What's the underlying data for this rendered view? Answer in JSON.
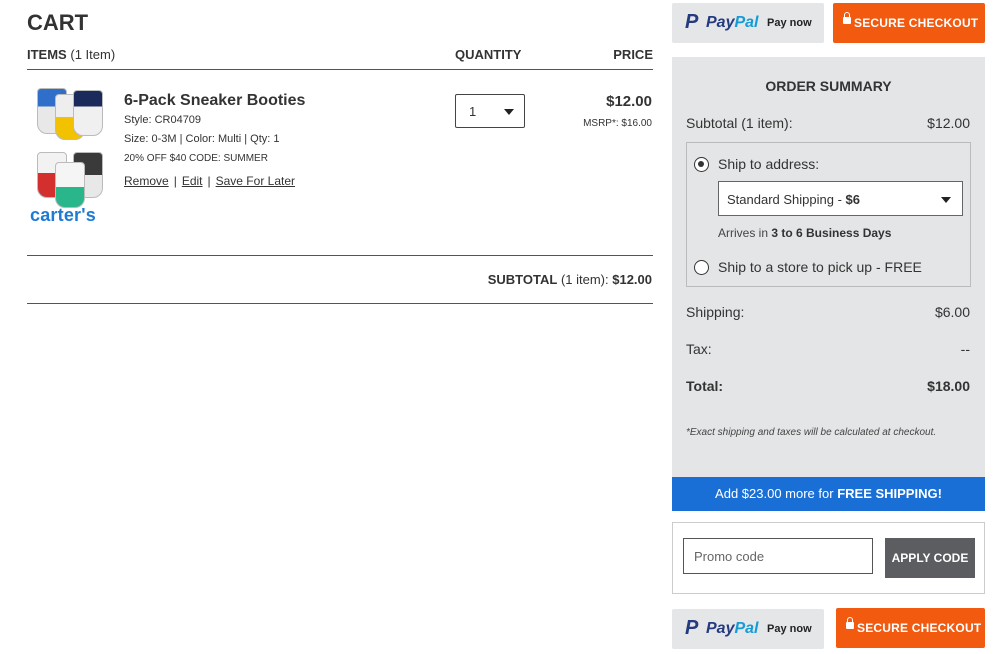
{
  "cart": {
    "title": "CART",
    "header": {
      "items_label": "ITEMS",
      "items_count": "(1 Item)",
      "quantity_label": "QUANTITY",
      "price_label": "PRICE"
    },
    "item": {
      "brand": "carter's",
      "name": "6-Pack Sneaker Booties",
      "style": "Style: CR04709",
      "details": "Size: 0-3M | Color: Multi | Qty: 1",
      "promo": "20% OFF $40 CODE: SUMMER",
      "links": {
        "remove": "Remove",
        "edit": "Edit",
        "save_for_later": "Save For Later",
        "separator": "|"
      },
      "quantity": "1",
      "price": "$12.00",
      "msrp": "MSRP*: $16.00",
      "image_icon": "socks-product-icon",
      "sock_colors": [
        "#2f6fc9",
        "#f2c200",
        "#1a2a5a",
        "#d32f2f",
        "#3a3a3a",
        "#29b68b"
      ]
    },
    "subtotal": {
      "label": "SUBTOTAL",
      "count": "(1 item):",
      "value": "$12.00"
    }
  },
  "buttons": {
    "paypal": {
      "p": "P",
      "pay": "Pay",
      "pal": "Pal",
      "now": "Pay now"
    },
    "secure_checkout": "SECURE CHECKOUT"
  },
  "summary": {
    "title": "ORDER SUMMARY",
    "subtotal_label": "Subtotal (1 item):",
    "subtotal_value": "$12.00",
    "ship_to_address": "Ship to address:",
    "shipping_option_name": "Standard Shipping - ",
    "shipping_option_price": "$6",
    "arrives_prefix": "Arrives in ",
    "arrives_window": "3 to 6 Business Days",
    "ship_to_store": "Ship to a store to pick up - FREE",
    "shipping_label": "Shipping:",
    "shipping_value": "$6.00",
    "tax_label": "Tax:",
    "tax_value": "--",
    "total_label": "Total:",
    "total_value": "$18.00",
    "note": "*Exact shipping and taxes will be calculated at checkout."
  },
  "free_shipping": {
    "prefix": "Add $23.00 more for ",
    "highlight": "FREE SHIPPING!"
  },
  "promo": {
    "placeholder": "Promo code",
    "apply_label": "APPLY CODE"
  },
  "colors": {
    "accent_orange": "#f25a10",
    "accent_blue": "#1a6fd6",
    "brand_blue": "#1e7bd4",
    "panel_gray": "#e4e5e6"
  }
}
